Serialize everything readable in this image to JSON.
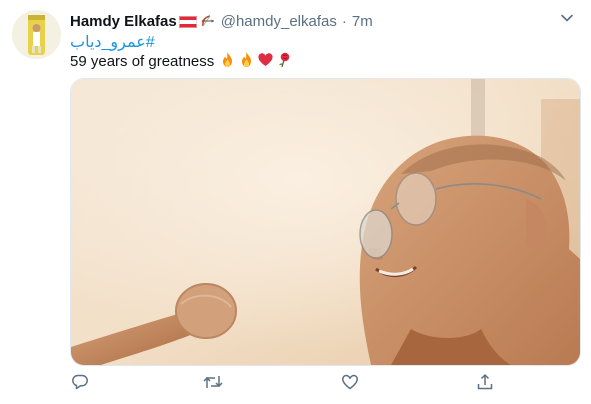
{
  "tweet": {
    "author_name": "Hamdy Elkafas",
    "handle": "@hamdy_elkafas",
    "separator": "·",
    "time": "7m",
    "hashtag": "#عمرو_دياب",
    "text": "59 years of greatness"
  },
  "icons": {
    "emojis": [
      "fire-icon",
      "fire-icon",
      "heart-icon",
      "rose-icon"
    ],
    "actions": [
      "reply-icon",
      "retweet-icon",
      "like-icon",
      "share-icon"
    ]
  },
  "colors": {
    "text": "#0f1419",
    "secondary": "#5b7083",
    "link": "#1b95e0",
    "action_icon": "#5b7083"
  }
}
